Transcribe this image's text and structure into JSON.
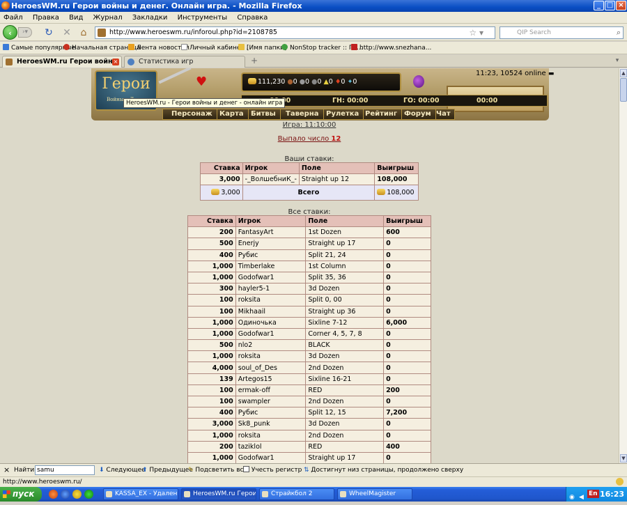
{
  "window": {
    "title": "HeroesWM.ru Герои войны и денег. Онлайн игра. - Mozilla Firefox",
    "min": "_",
    "max": "□",
    "close": "×"
  },
  "menu": [
    "Файл",
    "Правка",
    "Вид",
    "Журнал",
    "Закладки",
    "Инструменты",
    "Справка"
  ],
  "nav": {
    "url": "http://www.heroeswm.ru/inforoul.php?id=2108785",
    "search_placeholder": "QIP Search"
  },
  "bookmarks": [
    {
      "label": "Самые популярные",
      "color": "#3b7ad8"
    },
    {
      "label": "Начальная страница",
      "color": "#c83020"
    },
    {
      "label": "Лента новостей",
      "color": "#e8a020"
    },
    {
      "label": "Личный кабинет .",
      "color": "#ffffff"
    },
    {
      "label": "[Имя папки]",
      "color": "#e8c040"
    },
    {
      "label": "NonStop tracker :: Гл...",
      "color": "#40a040"
    },
    {
      "label": "http://www.snezhana...",
      "color": "#c02020"
    }
  ],
  "tabs": [
    {
      "label": "HeroesWM.ru Герои войны и ден...",
      "active": true
    },
    {
      "label": "Статистика игр",
      "active": false
    }
  ],
  "game": {
    "logo": "Герои",
    "logo_sub": "Войны и Денег",
    "resources": "111,230 [] 0 [] 0 [] 0 [] 0 [] 0 [] 0",
    "res_values": [
      "111,230",
      "0",
      "0",
      "0",
      "0",
      "0",
      "0"
    ],
    "timers": [
      "00:00",
      "ГН: 00:00",
      "ГО: 00:00",
      "00:00"
    ],
    "menu": [
      "Персонаж",
      "Карта",
      "Битвы",
      "Таверна",
      "Рулетка",
      "Рейтинг",
      "Форум",
      "Чат"
    ],
    "tooltip": "HeroesWM.ru - Герои войны и денег - онлайн игра",
    "clock": "11:23, 10524 online"
  },
  "roulette": {
    "game_time": "Игра: 11:10:00",
    "dropped_prefix": "Выпало число",
    "dropped_number": "12",
    "your_bets_caption": "Ваши ставки:",
    "all_bets_caption": "Все ставки:",
    "headers": [
      "Ставка",
      "Игрок",
      "Поле",
      "Выигрыш"
    ],
    "your_bets": [
      {
        "bet": "3,000",
        "player": "-_ВолшебниК_-",
        "field": "Straight up 12",
        "win": "108,000"
      }
    ],
    "your_total": {
      "bet": "3,000",
      "label": "Всего",
      "win": "108,000"
    },
    "all_bets": [
      {
        "bet": "200",
        "player": "FantasyArt",
        "field": "1st Dozen",
        "win": "600"
      },
      {
        "bet": "500",
        "player": "Enerjy",
        "field": "Straight up 17",
        "win": "0"
      },
      {
        "bet": "400",
        "player": "Рубис",
        "field": "Split 21, 24",
        "win": "0"
      },
      {
        "bet": "1,000",
        "player": "Timberlake",
        "field": "1st Column",
        "win": "0"
      },
      {
        "bet": "1,000",
        "player": "Godofwar1",
        "field": "Split 35, 36",
        "win": "0"
      },
      {
        "bet": "300",
        "player": "hayler5-1",
        "field": "3d Dozen",
        "win": "0"
      },
      {
        "bet": "100",
        "player": "roksita",
        "field": "Split 0, 00",
        "win": "0"
      },
      {
        "bet": "100",
        "player": "Mikhaail",
        "field": "Straight up 36",
        "win": "0"
      },
      {
        "bet": "1,000",
        "player": "Одиночька",
        "field": "Sixline 7-12",
        "win": "6,000"
      },
      {
        "bet": "1,000",
        "player": "Godofwar1",
        "field": "Corner 4, 5, 7, 8",
        "win": "0"
      },
      {
        "bet": "500",
        "player": "nlo2",
        "field": "BLACK",
        "win": "0"
      },
      {
        "bet": "1,000",
        "player": "roksita",
        "field": "3d Dozen",
        "win": "0"
      },
      {
        "bet": "4,000",
        "player": "soul_of_Des",
        "field": "2nd Dozen",
        "win": "0"
      },
      {
        "bet": "139",
        "player": "Artegos15",
        "field": "Sixline 16-21",
        "win": "0"
      },
      {
        "bet": "100",
        "player": "ermak-off",
        "field": "RED",
        "win": "200"
      },
      {
        "bet": "100",
        "player": "swampler",
        "field": "2nd Dozen",
        "win": "0"
      },
      {
        "bet": "400",
        "player": "Рубис",
        "field": "Split 12, 15",
        "win": "7,200"
      },
      {
        "bet": "3,000",
        "player": "Sk8_punk",
        "field": "3d Dozen",
        "win": "0"
      },
      {
        "bet": "1,000",
        "player": "roksita",
        "field": "2nd Dozen",
        "win": "0"
      },
      {
        "bet": "200",
        "player": "taziklol",
        "field": "RED",
        "win": "400"
      },
      {
        "bet": "1,000",
        "player": "Godofwar1",
        "field": "Straight up 17",
        "win": "0"
      }
    ]
  },
  "findbar": {
    "label": "Найти:",
    "value": "samu",
    "next": "Следующее",
    "prev": "Предыдущее",
    "highlight": "Подсветить все",
    "match_case": "Учесть регистр",
    "status": "Достигнут низ страницы, продолжено сверху"
  },
  "status": "http://www.heroeswm.ru/",
  "taskbar": {
    "start": "пуск",
    "items": [
      "KASSA_EX - Удаленн...",
      "HeroesWM.ru Герои ...",
      "Страйкбол 2",
      "WheelMagister"
    ],
    "lang": "En",
    "time": "16:23"
  }
}
